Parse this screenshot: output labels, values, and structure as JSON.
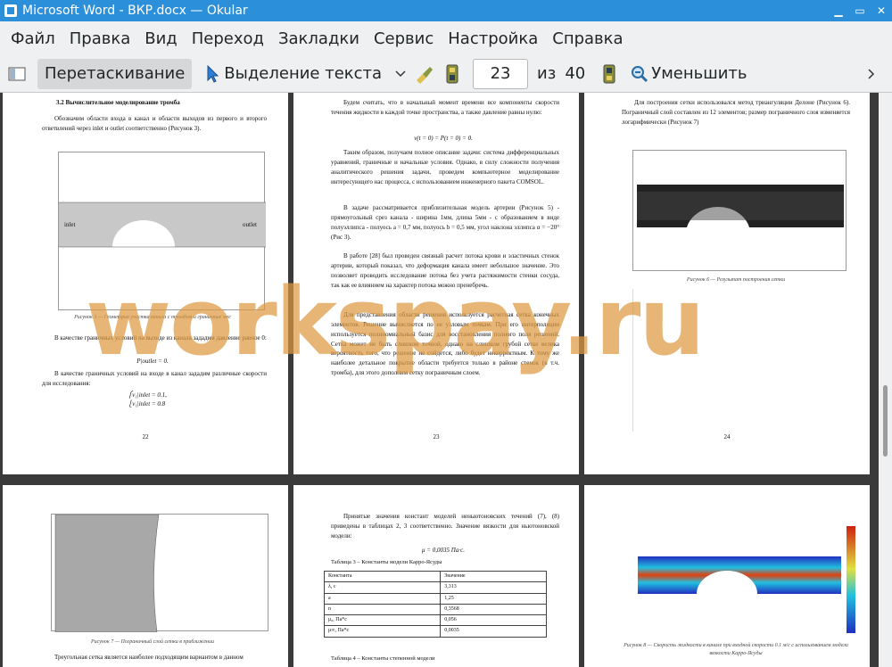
{
  "window": {
    "title": "Microsoft Word - ВКР.docx  — Okular"
  },
  "menu": [
    "Файл",
    "Правка",
    "Вид",
    "Переход",
    "Закладки",
    "Сервис",
    "Настройка",
    "Справка"
  ],
  "toolbar": {
    "drag": "Перетаскивание",
    "select_text": "Выделение текста",
    "page_current": "23",
    "of_label": "из",
    "page_total": "40",
    "zoom_out": "Уменьшить"
  },
  "watermark": "workspay.ru",
  "page22": {
    "heading": "3.2     Вычислительное моделирование тромба",
    "p1": "Обозначим области входа в канал и области выходов из первого и второго ответвлений через inlet и outlet соответственно (Рисунок 3).",
    "fig_inlet": "inlet",
    "fig_outlet": "outlet",
    "caption": "Рисунок 3 — Геометрия участка канала с тромбом и граничные мес",
    "p2": "В качестве граничных условий на выходе из канала зададим давление равное 0:",
    "eq1": "P|outlet = 0.",
    "p3": "В качестве граничных условий на входе в канал зададим различные скорости для исследования:",
    "eq2a": "⎧v₁|inlet = 0.1,",
    "eq2b": "⎩v₁|inlet = 0.8",
    "num": "22"
  },
  "page23": {
    "p1": "Будем считать, что в начальный момент времени все компоненты скорости течения жидкости в каждой точке пространства, а также давление равны нулю:",
    "eq1": "v(t = 0) = P(t = 0) = 0.",
    "p2": "Таким образом, получаем полное описание задачи: система дифференциальных уравнений, граничные и начальные условия. Однако, в силу сложности получения аналитического решения задачи, проведем компьютерное моделирование интересующего нас процесса, с использованием инженерного пакета COMSOL.",
    "p3": "В задаче рассматривается приблизительная модель артерии (Рисунок 5) - прямоугольный срез канала - ширина 1мм, длина 5мм - с образованием в виде полуэллипса - полуось a = 0,7 мм, полуось b = 0,5 мм, угол наклона эллипса α = −20° (Рис 3).",
    "p4": "В работе [28] был проведен связный расчет потока крови и эластичных стенок артерии, который показал, что деформация канала имеет небольшое значение. Это позволяет проводить исследование потока без учета растяжимости стенки сосуда, так как ее влиянием на характер потока можно пренебречь.",
    "p5": "Для представления области решения используется расчетная сетка конечных элементов. Решение вычисляется по ее узловым точкам. При его интерполяции используется полиномиальный базис для восстановления полного поля решений. Сетка может не быть слишком точной, однако на слишком грубой сетке велика вероятность того, что решение не сойдется, либо будет некорректным. К тому же наиболее детальное покрытие области требуется только в районе стенок (в т.ч. тромба), для этого дополним сетку пограничным слоем.",
    "num": "23"
  },
  "page24": {
    "p1": "Для построения сетки использовался метод триангуляции Делоне (Рисунок 6). Пограничный слой составлен из 12 элементов; размер пограничного слоя изменяется логарифмически (Рисунок 7)",
    "caption": "Рисунок 6 — Результат построения сетки",
    "num": "24"
  },
  "page25": {
    "caption": "Рисунок 7 — Пограничный слой сетки в приближении",
    "p1": "Треугольная сетка является наиболее подходящим вариантом в данном"
  },
  "page26": {
    "p1": "Принятые значения констант моделей неньютоновских течений (7), (8) приведены в таблицах 2, 3 соответственно. Значение вязкости для ньютоновской модели:",
    "eq1": "μ = 0,0035 Па·с.",
    "table_title": "Таблица 3 – Константы модели Карро-Ясуды",
    "table_head": [
      "Константа",
      "Значение"
    ],
    "table_rows": [
      [
        "λ, с",
        "3,313"
      ],
      [
        "a",
        "1,25"
      ],
      [
        "n",
        "0,3568"
      ],
      [
        "μ₀, Па*с",
        "0,056"
      ],
      [
        "μ∞, Па*с",
        "0,0035"
      ]
    ],
    "table2_title": "Таблица 4 – Константы степенной модели"
  },
  "page27": {
    "caption": "Рисунок 8 — Скорость жидкости в канале при входной скорости 0.1 м/с с использованием модели вязкости Карро-Ясуды"
  },
  "colors": {
    "titlebar": "#2b90d9",
    "watermark": "#de9940"
  }
}
